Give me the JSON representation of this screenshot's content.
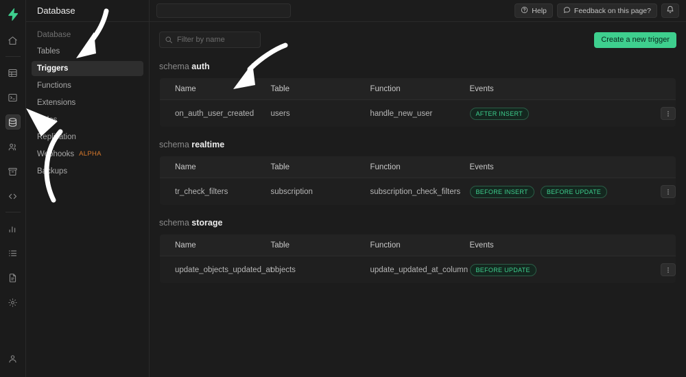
{
  "rail": {
    "logo": "supabase-logo",
    "items": [
      {
        "name": "home-icon"
      },
      {
        "name": "table-editor-icon"
      },
      {
        "name": "sql-editor-icon"
      },
      {
        "name": "database-icon",
        "active": true
      },
      {
        "name": "auth-users-icon"
      },
      {
        "name": "storage-icon"
      },
      {
        "name": "edge-functions-icon"
      },
      {
        "name": "reports-icon"
      },
      {
        "name": "logs-icon"
      },
      {
        "name": "api-docs-icon"
      },
      {
        "name": "settings-icon"
      }
    ],
    "bottom": {
      "name": "account-icon"
    }
  },
  "sidebar": {
    "title": "Database",
    "group_label": "Database",
    "items": [
      {
        "label": "Tables",
        "active": false
      },
      {
        "label": "Triggers",
        "active": true
      },
      {
        "label": "Functions",
        "active": false
      },
      {
        "label": "Extensions",
        "active": false
      },
      {
        "label": "Roles",
        "active": false
      },
      {
        "label": "Replication",
        "active": false
      },
      {
        "label": "Webhooks",
        "active": false,
        "badge": "ALPHA"
      },
      {
        "label": "Backups",
        "active": false
      }
    ]
  },
  "topbar": {
    "search_value": "",
    "search_placeholder": "",
    "help_label": "Help",
    "feedback_label": "Feedback on this page?",
    "notifications_label": "notifications"
  },
  "toolbar": {
    "filter_value": "",
    "filter_placeholder": "Filter by name",
    "create_label": "Create a new trigger"
  },
  "table": {
    "columns": [
      "Name",
      "Table",
      "Function",
      "Events"
    ]
  },
  "schemas": [
    {
      "prefix": "schema",
      "name": "auth",
      "rows": [
        {
          "name": "on_auth_user_created",
          "table": "users",
          "function": "handle_new_user",
          "events": [
            "AFTER INSERT"
          ]
        }
      ]
    },
    {
      "prefix": "schema",
      "name": "realtime",
      "rows": [
        {
          "name": "tr_check_filters",
          "table": "subscription",
          "function": "subscription_check_filters",
          "events": [
            "BEFORE INSERT",
            "BEFORE UPDATE"
          ]
        }
      ]
    },
    {
      "prefix": "schema",
      "name": "storage",
      "rows": [
        {
          "name": "update_objects_updated_at",
          "table": "objects",
          "function": "update_updated_at_column",
          "events": [
            "BEFORE UPDATE"
          ]
        }
      ]
    }
  ],
  "colors": {
    "accent": "#3ecf8e",
    "badge_text": "#3ecf8e",
    "badge_border": "#2b5c46",
    "alpha_badge": "#d97a2c",
    "background": "#1c1c1c",
    "panel": "#1f1f1f",
    "header_row": "#232323"
  }
}
